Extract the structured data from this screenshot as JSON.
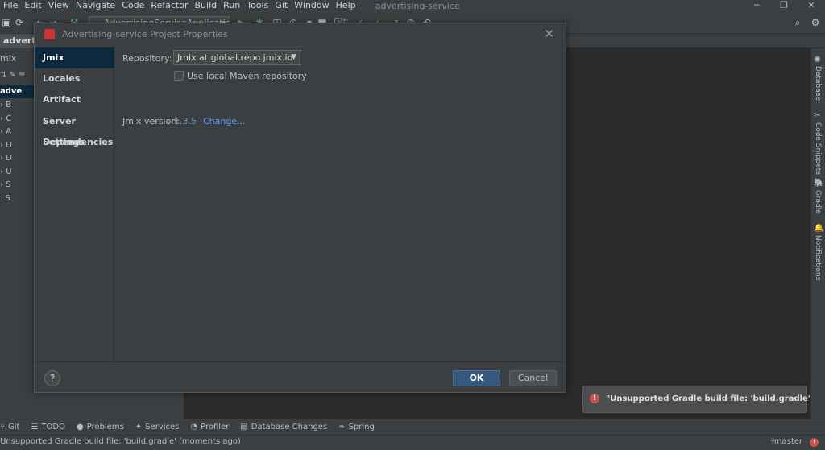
{
  "menubar": {
    "items": [
      "File",
      "Edit",
      "View",
      "Navigate",
      "Code",
      "Refactor",
      "Build",
      "Run",
      "Tools",
      "Git",
      "Window",
      "Help"
    ],
    "app_title": "advertising-service"
  },
  "toolbar": {
    "run_config": "AdvertisingServiceApplication",
    "git_label": "Git:"
  },
  "project_panel": {
    "tab_label": "advertising-se",
    "header_label": "mix",
    "tree": [
      {
        "label": "adve",
        "selected": true
      },
      {
        "label": "B"
      },
      {
        "label": "C"
      },
      {
        "label": "A"
      },
      {
        "label": "D"
      },
      {
        "label": "D"
      },
      {
        "label": "U"
      },
      {
        "label": "S"
      },
      {
        "label": "S"
      }
    ]
  },
  "dialog": {
    "title": "Advertising-service Project Properties",
    "nav": [
      {
        "label": "Jmix",
        "active": true
      },
      {
        "label": "Locales"
      },
      {
        "label": "Artifact"
      },
      {
        "label": "Server Settings"
      },
      {
        "label": "Dependencies"
      }
    ],
    "repository_label": "Repository:",
    "repository_value": "Jmix at global.repo.jmix.io",
    "local_maven_label": "Use local Maven repository",
    "local_maven_checked": false,
    "version_label": "Jmix version:",
    "version_value": "1.3.5",
    "change_link": "Change...",
    "help_label": "?",
    "ok_label": "OK",
    "cancel_label": "Cancel"
  },
  "right_strip": {
    "tabs": [
      "Database",
      "Code Snippets",
      "Gradle",
      "Notifications"
    ]
  },
  "notification": {
    "message": "\"Unsupported Gradle build file: 'build.gradle'"
  },
  "bottom_tools": [
    {
      "icon": "git-icon",
      "glyph": "⑂",
      "label": "Git"
    },
    {
      "icon": "todo-icon",
      "glyph": "☰",
      "label": "TODO"
    },
    {
      "icon": "problems-icon",
      "glyph": "●",
      "label": "Problems"
    },
    {
      "icon": "services-icon",
      "glyph": "✦",
      "label": "Services"
    },
    {
      "icon": "profiler-icon",
      "glyph": "◔",
      "label": "Profiler"
    },
    {
      "icon": "database-changes-icon",
      "glyph": "▤",
      "label": "Database Changes"
    },
    {
      "icon": "spring-icon",
      "glyph": "❧",
      "label": "Spring"
    }
  ],
  "statusbar": {
    "message": "Unsupported Gradle build file: 'build.gradle' (moments ago)",
    "branch": "master"
  },
  "colors": {
    "accent": "#365880",
    "selection": "#0d293e",
    "link": "#589df6",
    "error": "#c75450",
    "run_green": "#59a869"
  }
}
